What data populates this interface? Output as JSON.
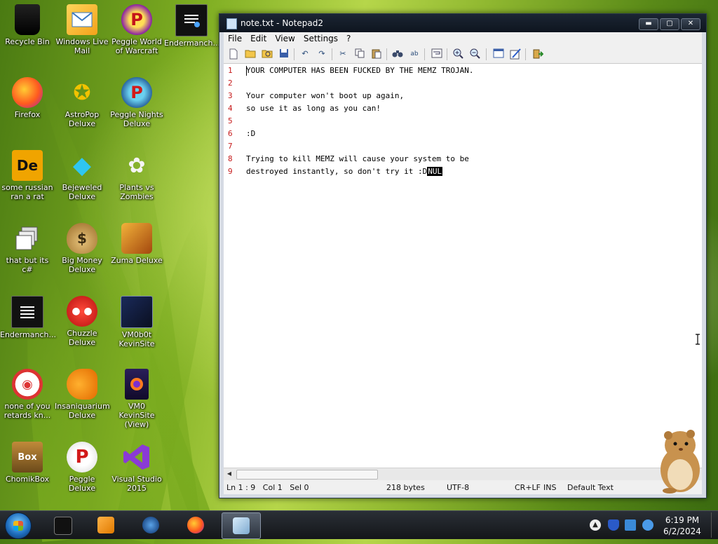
{
  "desktop": {
    "icons": [
      {
        "label": "Recycle Bin"
      },
      {
        "label": "Windows Live Mail"
      },
      {
        "label": "Peggle World of Warcraft"
      },
      {
        "label": "Endermanch..."
      },
      {
        "label": "Firefox"
      },
      {
        "label": "AstroPop Deluxe"
      },
      {
        "label": "Peggle Nights Deluxe"
      },
      {
        "label": "some russian ran a rat"
      },
      {
        "label": "Bejeweled Deluxe"
      },
      {
        "label": "Plants vs Zombies"
      },
      {
        "label": "that but its c#"
      },
      {
        "label": "Big Money Deluxe"
      },
      {
        "label": "Zuma Deluxe"
      },
      {
        "label": "Endermanch..."
      },
      {
        "label": "Chuzzle Deluxe"
      },
      {
        "label": "VM0b0t KevinSite"
      },
      {
        "label": "none of you retards kn..."
      },
      {
        "label": "Insaniquarium Deluxe"
      },
      {
        "label": "VM0 KevinSite (View)"
      },
      {
        "label": "ChomikBox"
      },
      {
        "label": "Peggle Deluxe"
      },
      {
        "label": "Visual Studio 2015"
      }
    ],
    "icon_glyphs": [
      "",
      "",
      "P",
      "",
      "",
      "",
      "P",
      "De",
      "",
      "",
      "",
      "$",
      "",
      "",
      "",
      "",
      "",
      "",
      "",
      "Box",
      "P",
      ""
    ]
  },
  "window": {
    "title": "note.txt - Notepad2",
    "buttons": {
      "minimize": "▬",
      "maximize": "▢",
      "close": "✕"
    },
    "menu": [
      "File",
      "Edit",
      "View",
      "Settings",
      "?"
    ],
    "lines": [
      {
        "num": "1",
        "text": "YOUR COMPUTER HAS BEEN FUCKED BY THE MEMZ TROJAN."
      },
      {
        "num": "2",
        "text": ""
      },
      {
        "num": "3",
        "text": "Your computer won't boot up again,"
      },
      {
        "num": "4",
        "text": "so use it as long as you can!"
      },
      {
        "num": "5",
        "text": ""
      },
      {
        "num": "6",
        "text": ":D"
      },
      {
        "num": "7",
        "text": ""
      },
      {
        "num": "8",
        "text": "Trying to kill MEMZ will cause your system to be"
      },
      {
        "num": "9",
        "text": "destroyed instantly, so don't try it :D"
      }
    ],
    "nul_marker": "NUL",
    "status": {
      "position": "Ln 1 : 9   Col 1   Sel 0",
      "size": "218 bytes",
      "encoding": "UTF-8",
      "eol": "CR+LF",
      "mode": "INS",
      "scheme": "Default Text"
    }
  },
  "taskbar": {
    "clock_time": "6:19 PM",
    "clock_date": "6/2/2024"
  },
  "colors": {
    "line_number": "#c61a1a",
    "titlebar": "#0e151f",
    "taskbar": "#141619"
  }
}
